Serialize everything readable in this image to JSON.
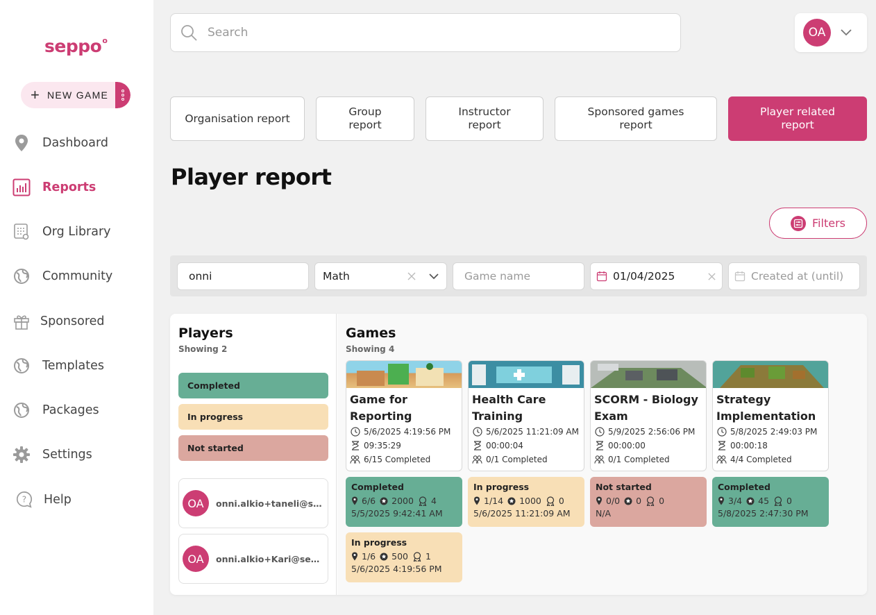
{
  "app": {
    "logo": "seppo"
  },
  "sidebar": {
    "new_game_label": "NEW GAME",
    "items": [
      {
        "label": "Dashboard",
        "icon": "map-pin-icon"
      },
      {
        "label": "Reports",
        "icon": "bar-chart-icon",
        "active": true
      },
      {
        "label": "Org Library",
        "icon": "library-icon"
      },
      {
        "label": "Community",
        "icon": "globe-icon"
      },
      {
        "label": "Sponsored",
        "icon": "gift-icon"
      },
      {
        "label": "Templates",
        "icon": "globe-icon"
      },
      {
        "label": "Packages",
        "icon": "globe-icon"
      },
      {
        "label": "Settings",
        "icon": "gear-icon"
      },
      {
        "label": "Help",
        "icon": "help-icon"
      }
    ]
  },
  "header": {
    "search_placeholder": "Search",
    "user_initials": "OA"
  },
  "tabs": [
    {
      "label": "Organisation report"
    },
    {
      "label": "Group report"
    },
    {
      "label": "Instructor report"
    },
    {
      "label": "Sponsored games report"
    },
    {
      "label": "Player related report",
      "active": true
    }
  ],
  "page": {
    "title": "Player report",
    "filters_label": "Filters"
  },
  "filters": {
    "player_value": "onni",
    "subject_value": "Math",
    "game_name_placeholder": "Game name",
    "created_from_value": "01/04/2025",
    "created_until_placeholder": "Created at (until)"
  },
  "players": {
    "title": "Players",
    "showing": "Showing 2",
    "legend": {
      "completed": "Completed",
      "in_progress": "In progress",
      "not_started": "Not started"
    },
    "list": [
      {
        "initials": "OA",
        "email": "onni.alkio+taneli@seppo.io"
      },
      {
        "initials": "OA",
        "email": "onni.alkio+Kari@seppo.io"
      }
    ]
  },
  "games": {
    "title": "Games",
    "showing": "Showing 4",
    "list": [
      {
        "title": "Game for Reporting",
        "created": "5/6/2025 4:19:56 PM",
        "duration": "09:35:29",
        "completed": "6/15 Completed",
        "thumb_color": "#8fd3e8"
      },
      {
        "title": "Health Care Training",
        "created": "5/6/2025 11:21:09 AM",
        "duration": "00:00:04",
        "completed": "0/1 Completed",
        "thumb_color": "#5aa3b7"
      },
      {
        "title": "SCORM - Biology Exam",
        "created": "5/9/2025 2:56:06 PM",
        "duration": "00:00:00",
        "completed": "0/1 Completed",
        "thumb_color": "#9aa4a0"
      },
      {
        "title": "Strategy Implementation",
        "created": "5/8/2025 2:49:03 PM",
        "duration": "00:00:18",
        "completed": "4/4 Completed",
        "thumb_color": "#7a9a4a"
      }
    ],
    "statuses": [
      {
        "status": "Completed",
        "tasks": "6/6",
        "points": "2000",
        "badges": "4",
        "date": "5/5/2025 9:42:41 AM",
        "color": "#67ae95"
      },
      {
        "status": "In progress",
        "tasks": "1/14",
        "points": "1000",
        "badges": "0",
        "date": "5/6/2025 11:21:09 AM",
        "color": "#f8dfb6"
      },
      {
        "status": "Not started",
        "tasks": "0/0",
        "points": "0",
        "badges": "0",
        "date": "N/A",
        "color": "#dba79f"
      },
      {
        "status": "Completed",
        "tasks": "3/4",
        "points": "45",
        "badges": "0",
        "date": "5/8/2025 2:47:30 PM",
        "color": "#67ae95"
      },
      {
        "status": "In progress",
        "tasks": "1/6",
        "points": "500",
        "badges": "1",
        "date": "5/6/2025 4:19:56 PM",
        "color": "#f8dfb6"
      }
    ]
  },
  "colors": {
    "accent": "#cc3d73",
    "completed": "#67ae95",
    "in_progress": "#f8dfb6",
    "not_started": "#dba79f"
  }
}
